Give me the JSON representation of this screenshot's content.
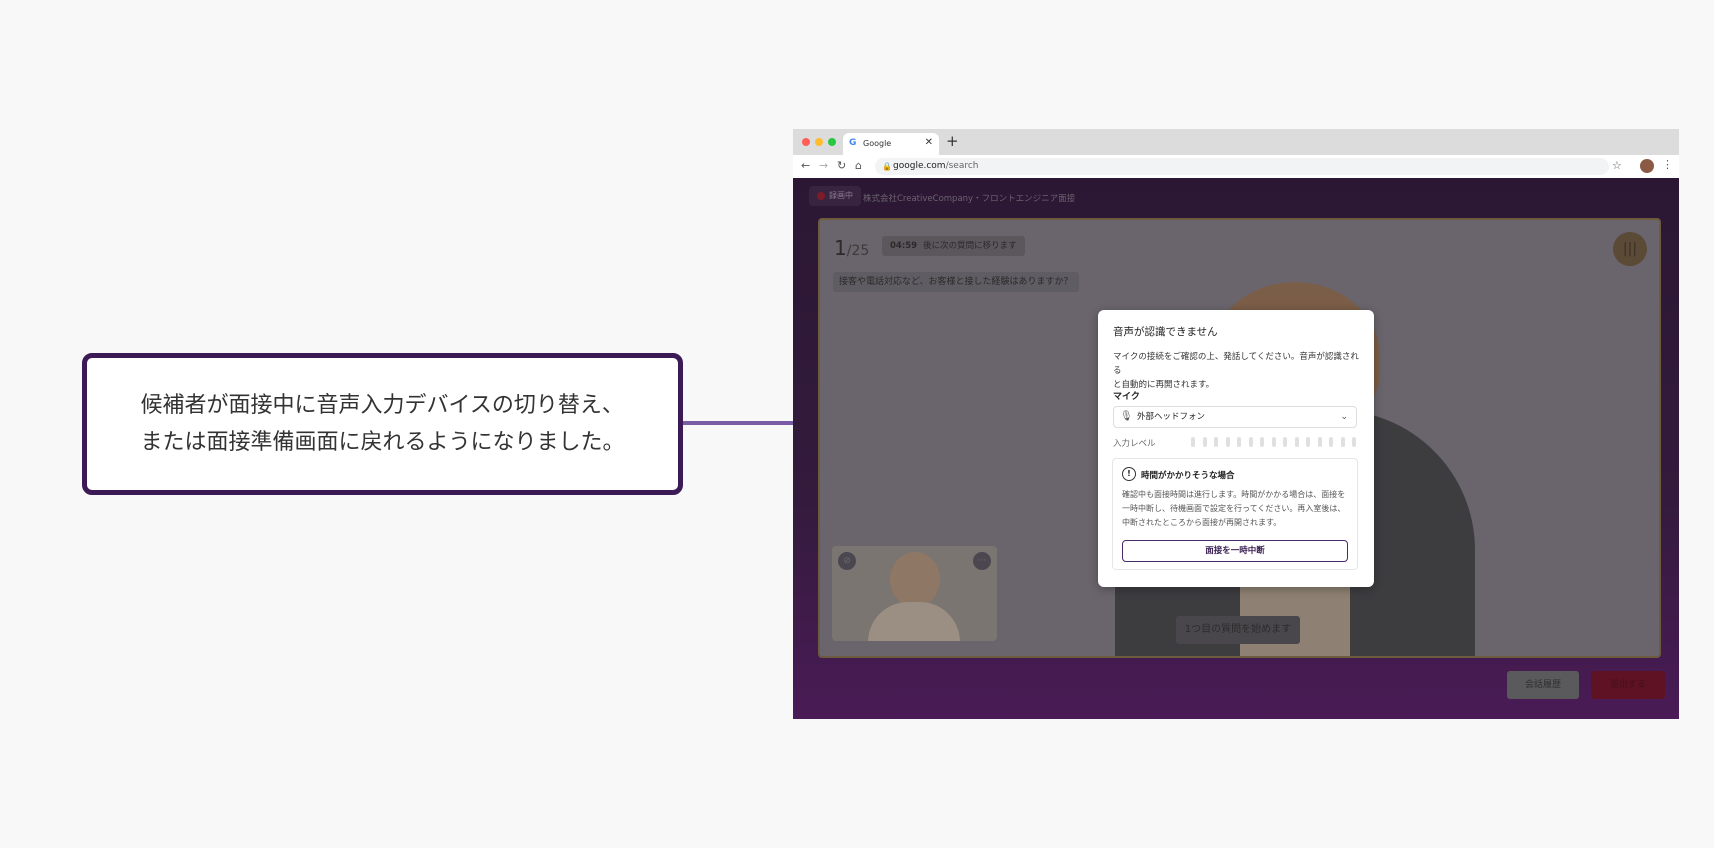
{
  "callout": {
    "line1": "候補者が面接中に音声入力デバイスの切り替え、",
    "line2": "または面接準備画面に戻れるようになりました。"
  },
  "browser": {
    "tab_title": "Google",
    "url_host": "google.com",
    "url_path": "/search"
  },
  "app": {
    "recording_label": "録画中",
    "company_title": "株式会社CreativeCompany・フロントエンジニア面接",
    "question_index": "1",
    "question_total": "/25",
    "timer": "04:59",
    "timer_suffix": "後に次の質問に移ります",
    "question_text": "接客や電話対応など、お客様と接した経験はありますか？",
    "caption": "1つ目の質問を始めます",
    "history_button": "会話履歴",
    "exit_button": "退出する"
  },
  "modal": {
    "title": "音声が認識できません",
    "desc_line1": "マイクの接続をご確認の上、発話してください。音声が認識される",
    "desc_line2": "と自動的に再開されます。",
    "mic_label": "マイク",
    "mic_value": "外部ヘッドフォン",
    "level_label": "入力レベル",
    "input_level": 0,
    "card_title": "時間がかかりそうな場合",
    "card_line1": "確認中も面接時間は進行します。時間がかかる場合は、面接を",
    "card_line2": "一時中断し、待機画面で設定を行ってください。再入室後は、",
    "card_line3": "中断されたところから面接が再開されます。",
    "pause_button": "面接を一時中断"
  },
  "icons": {
    "recording": "recording-dot-icon",
    "mic": "microphone-icon",
    "chevron": "chevron-down-icon",
    "warning": "exclamation-circle-icon",
    "voice": "voice-wave-icon"
  }
}
